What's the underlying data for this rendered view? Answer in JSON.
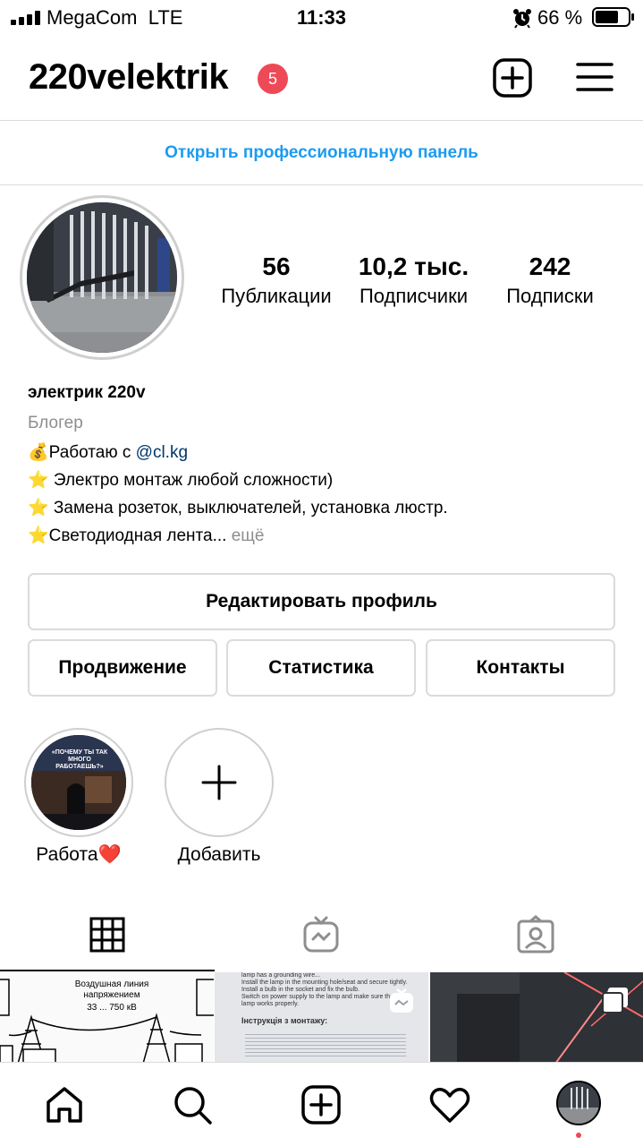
{
  "status": {
    "carrier": "MegaCom",
    "network": "LTE",
    "time": "11:33",
    "battery_pct": "66 %",
    "icons": [
      "signal-bars-icon",
      "alarm-icon",
      "battery-icon"
    ]
  },
  "header": {
    "username": "220velektrik",
    "notification_count": "5",
    "icons": [
      "new-post-icon",
      "menu-icon"
    ]
  },
  "pro_panel": {
    "label": "Открыть профессиональную панель"
  },
  "stats": [
    {
      "value": "56",
      "label": "Публикации"
    },
    {
      "value": "10,2 тыс.",
      "label": "Подписчики"
    },
    {
      "value": "242",
      "label": "Подписки"
    }
  ],
  "profile": {
    "name": "электрик 220v",
    "category": "Блогер",
    "bio": {
      "line1_prefix": "💰Работаю с ",
      "line1_mention": "@cl.kg",
      "line2": "⭐ Электро монтаж любой сложности)",
      "line3": "⭐ Замена розеток, выключателей, установка люстр.",
      "line4": "⭐Светодиодная лента... ",
      "more": "ещё"
    }
  },
  "buttons": {
    "edit_profile": "Редактировать профиль",
    "promotion": "Продвижение",
    "statistics": "Статистика",
    "contacts": "Контакты"
  },
  "highlights": [
    {
      "label": "Работа❤️",
      "cover_text": "«ПОЧЕМУ ТЫ ТАК МНОГО РАБОТАЕШЬ?»"
    },
    {
      "label": "Добавить"
    }
  ],
  "tabs": [
    "grid-icon",
    "igtv-icon",
    "tagged-icon"
  ],
  "grid": {
    "post1": {
      "title": "Воздушная линия напряжением",
      "voltage": "33 ... 750 кВ"
    },
    "post2": {
      "lines": [
        "lamp has a grounding wire...",
        "Install the lamp in the mounting hole/seat and secure tightly.",
        "Install a bulb in the socket and fix the bulb.",
        "Switch on power supply to the lamp and make sure that the lamp works properly."
      ],
      "heading": "Інструкція з монтажу:"
    }
  },
  "bottom_nav": [
    "home-icon",
    "search-icon",
    "new-post-icon",
    "activity-icon",
    "profile-avatar"
  ],
  "colors": {
    "accent_blue": "#1d9bf0",
    "badge_red": "#ed4956",
    "divider": "#dbdbdb"
  }
}
